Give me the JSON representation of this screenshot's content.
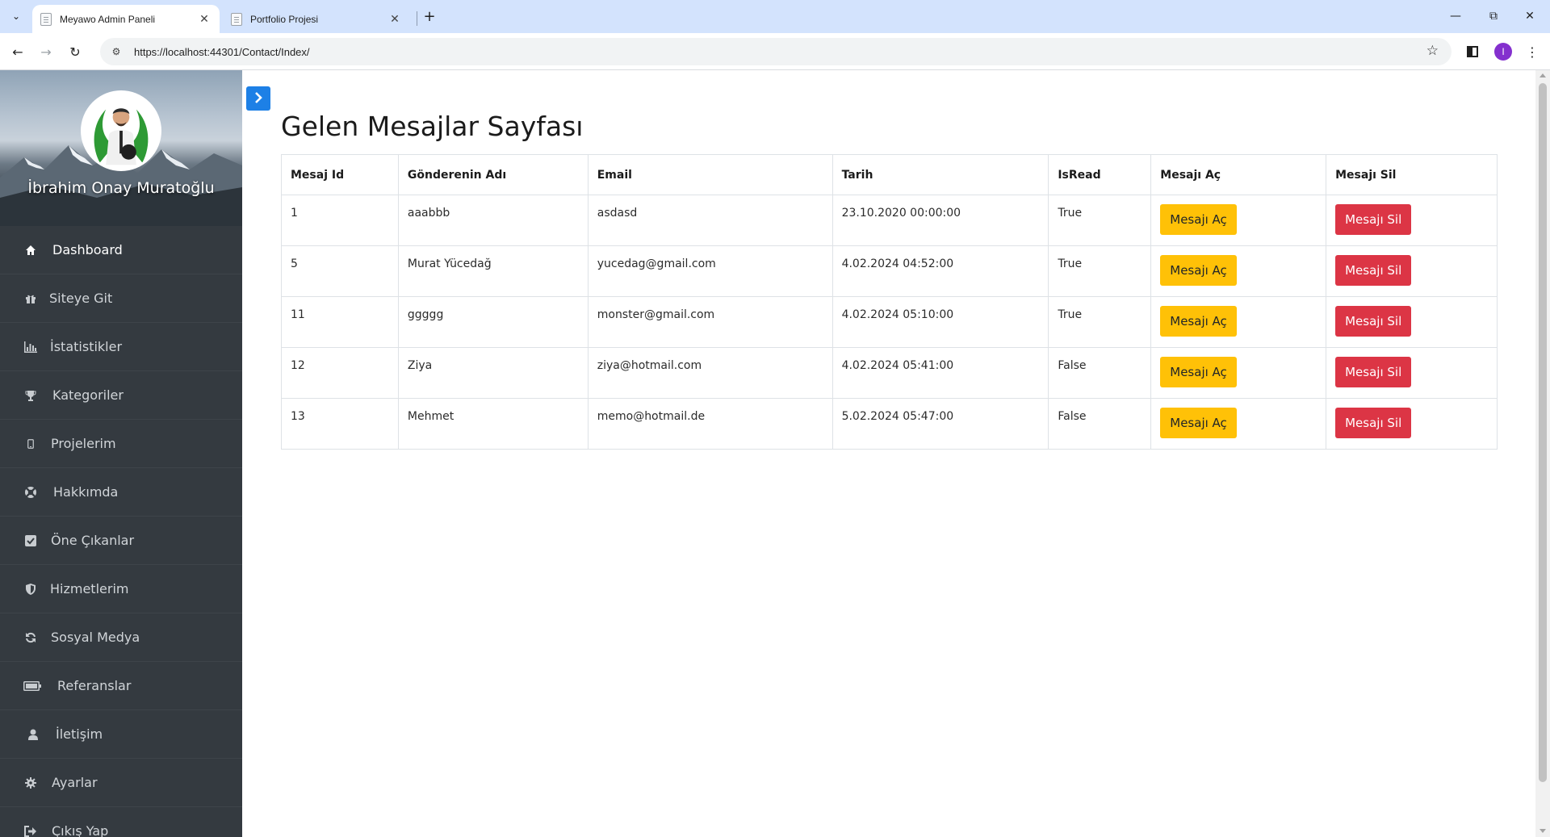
{
  "browser": {
    "tabs": [
      {
        "title": "Meyawo Admin Paneli",
        "active": true
      },
      {
        "title": "Portfolio Projesi",
        "active": false
      }
    ],
    "url": "https://localhost:44301/Contact/Index/",
    "profile_initial": "I",
    "profile_color": "#8430ce"
  },
  "sidebar": {
    "profile_name": "İbrahim Onay Muratoğlu",
    "items": [
      {
        "label": "Dashboard",
        "icon": "home-icon"
      },
      {
        "label": "Siteye Git",
        "icon": "gift-icon"
      },
      {
        "label": "İstatistikler",
        "icon": "bar-chart-icon"
      },
      {
        "label": "Kategoriler",
        "icon": "trophy-icon"
      },
      {
        "label": "Projelerim",
        "icon": "mobile-icon"
      },
      {
        "label": "Hakkımda",
        "icon": "life-ring-icon"
      },
      {
        "label": "Öne Çıkanlar",
        "icon": "check-square-icon"
      },
      {
        "label": "Hizmetlerim",
        "icon": "shield-icon"
      },
      {
        "label": "Sosyal Medya",
        "icon": "refresh-icon"
      },
      {
        "label": "Referanslar",
        "icon": "battery-icon"
      },
      {
        "label": "İletişim",
        "icon": "user-icon"
      },
      {
        "label": "Ayarlar",
        "icon": "gear-icon"
      },
      {
        "label": "Çıkış Yap",
        "icon": "sign-out-icon"
      }
    ]
  },
  "main": {
    "title": "Gelen Mesajlar Sayfası",
    "table": {
      "headers": [
        "Mesaj Id",
        "Gönderenin Adı",
        "Email",
        "Tarih",
        "IsRead",
        "Mesajı Aç",
        "Mesajı Sil"
      ],
      "rows": [
        {
          "id": "1",
          "name": "aaabbb",
          "email": "asdasd",
          "date": "23.10.2020 00:00:00",
          "is_read": "True"
        },
        {
          "id": "5",
          "name": "Murat Yücedağ",
          "email": "yucedag@gmail.com",
          "date": "4.02.2024 04:52:00",
          "is_read": "True"
        },
        {
          "id": "11",
          "name": "ggggg",
          "email": "monster@gmail.com",
          "date": "4.02.2024 05:10:00",
          "is_read": "True"
        },
        {
          "id": "12",
          "name": "Ziya",
          "email": "ziya@hotmail.com",
          "date": "4.02.2024 05:41:00",
          "is_read": "False"
        },
        {
          "id": "13",
          "name": "Mehmet",
          "email": "memo@hotmail.de",
          "date": "5.02.2024 05:47:00",
          "is_read": "False"
        }
      ],
      "open_label": "Mesajı Aç",
      "delete_label": "Mesajı Sil"
    }
  },
  "colors": {
    "sidebar_bg": "#343a40",
    "open_button": "#ffc107",
    "delete_button": "#dc3545",
    "toggle_button": "#1d80e6"
  }
}
